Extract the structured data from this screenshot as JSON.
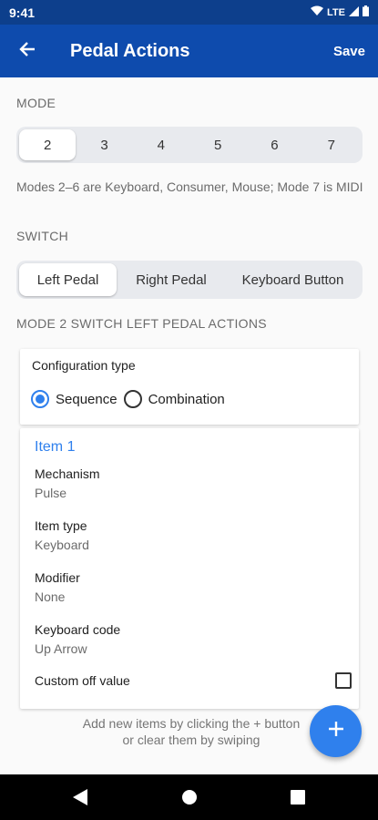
{
  "status_bar": {
    "time": "9:41",
    "network": "LTE",
    "icons": [
      "wifi-icon",
      "signal-icon",
      "battery-icon"
    ]
  },
  "app_bar": {
    "title": "Pedal Actions",
    "save_label": "Save",
    "back_icon": "arrow-left-icon"
  },
  "mode_section": {
    "label": "MODE",
    "options": [
      "2",
      "3",
      "4",
      "5",
      "6",
      "7"
    ],
    "selected": "2",
    "help_text": "Modes 2–6 are Keyboard, Consumer, Mouse; Mode 7 is MIDI"
  },
  "switch_section": {
    "label": "SWITCH",
    "options": [
      "Left Pedal",
      "Right Pedal",
      "Keyboard Button"
    ],
    "selected": "Left Pedal"
  },
  "actions_section": {
    "label": "MODE 2 SWITCH LEFT PEDAL ACTIONS"
  },
  "config": {
    "title": "Configuration type",
    "options": [
      "Sequence",
      "Combination"
    ],
    "selected": "Sequence"
  },
  "item": {
    "title": "Item 1",
    "fields": [
      {
        "label": "Mechanism",
        "value": "Pulse"
      },
      {
        "label": "Item type",
        "value": "Keyboard"
      },
      {
        "label": "Modifier",
        "value": "None"
      },
      {
        "label": "Keyboard code",
        "value": "Up Arrow"
      }
    ],
    "custom_off_label": "Custom off value",
    "custom_off_checked": false
  },
  "hint": {
    "line1": "Add new items by clicking the + button",
    "line2": "or clear them by swiping"
  },
  "colors": {
    "status_bar": "#0d3f8c",
    "app_bar": "#0e4bad",
    "accent": "#2f80ed"
  }
}
